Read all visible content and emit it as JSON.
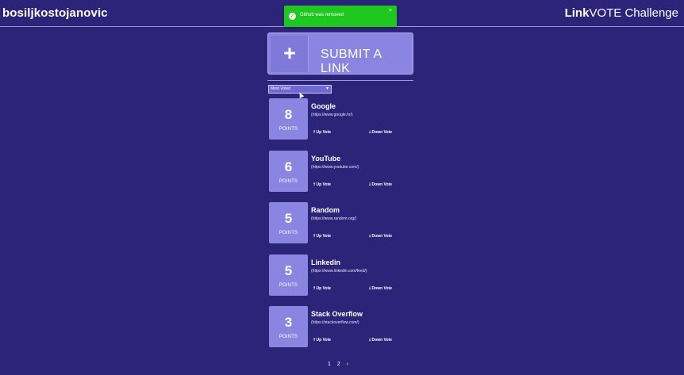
{
  "header": {
    "username": "bosiljkostojanovic",
    "title_bold": "Link",
    "title_rest": "VOTE Challenge"
  },
  "toast": {
    "icon": "check-circle-icon",
    "message": "Github was removed",
    "close_label": "×"
  },
  "submit": {
    "plus": "+",
    "label": "SUBMIT A LINK"
  },
  "sort": {
    "selected": "Most Voted",
    "chevron": "⌄"
  },
  "links": [
    {
      "points": "8",
      "points_label": "POINTS",
      "title": "Google",
      "url": "(https://www.google.hr/)",
      "up": "🠕 Up Vote",
      "down": "🠗 Down Vote"
    },
    {
      "points": "6",
      "points_label": "POINTS",
      "title": "YouTube",
      "url": "(https://www.youtube.com/)",
      "up": "🠕 Up Vote",
      "down": "🠗 Down Vote"
    },
    {
      "points": "5",
      "points_label": "POINTS",
      "title": "Random",
      "url": "(https://www.random.org/)",
      "up": "🠕 Up Vote",
      "down": "🠗 Down Vote"
    },
    {
      "points": "5",
      "points_label": "POINTS",
      "title": "Linkedin",
      "url": "(https://www.linkedin.com/feed/)",
      "up": "🠕 Up Vote",
      "down": "🠗 Down Vote"
    },
    {
      "points": "3",
      "points_label": "POINTS",
      "title": "Stack Overflow",
      "url": "(https://stackoverflow.com/)",
      "up": "🠕 Up Vote",
      "down": "🠗 Down Vote"
    }
  ],
  "pagination": {
    "pages": [
      "1",
      "2"
    ],
    "next": "›"
  },
  "colors": {
    "background": "#2b2478",
    "card": "#8a85e0",
    "toast": "#1ec81e"
  }
}
